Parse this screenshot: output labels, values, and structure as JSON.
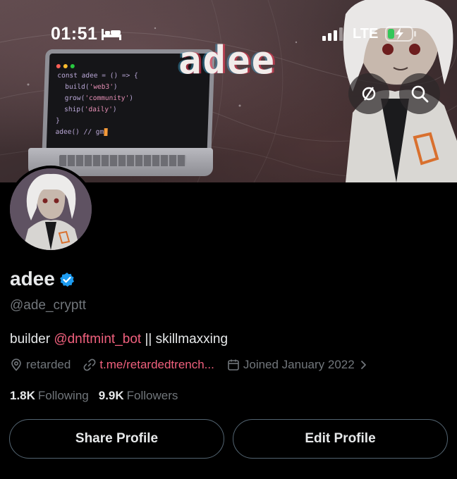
{
  "status_bar": {
    "time": "01:51",
    "network": "LTE",
    "icons": [
      "bed-icon",
      "signal-icon",
      "battery-charging-icon"
    ]
  },
  "banner": {
    "title": "adee",
    "code_lines": {
      "line1_kw": "const adee = () => {",
      "line2_fn": "build(",
      "line2_str": "'web3'",
      "line2_end": ")",
      "line3_fn": "grow(",
      "line3_str": "'community'",
      "line3_end": ")",
      "line4_fn": "ship(",
      "line4_str": "'daily'",
      "line4_end": ")",
      "line5": "}",
      "line6": "adee() // gm"
    },
    "buttons": [
      "sync-icon",
      "search-icon"
    ]
  },
  "profile": {
    "display_name": "adee",
    "verified": true,
    "handle": "@ade_cryptt",
    "bio": {
      "prefix": "builder ",
      "mention": "@dnftmint_bot",
      "suffix": " || skillmaxxing"
    },
    "location": "retarded",
    "link": "t.me/retardedtrench...",
    "joined": "Joined January 2022",
    "following_count": "1.8K",
    "following_label": "Following",
    "followers_count": "9.9K",
    "followers_label": "Followers"
  },
  "actions": {
    "share_label": "Share Profile",
    "edit_label": "Edit Profile"
  },
  "colors": {
    "background": "#000000",
    "text_primary": "#e7e9ea",
    "text_secondary": "#71767b",
    "accent_link": "#f0607d",
    "verified": "#1d9bf0",
    "button_border": "#536471"
  }
}
